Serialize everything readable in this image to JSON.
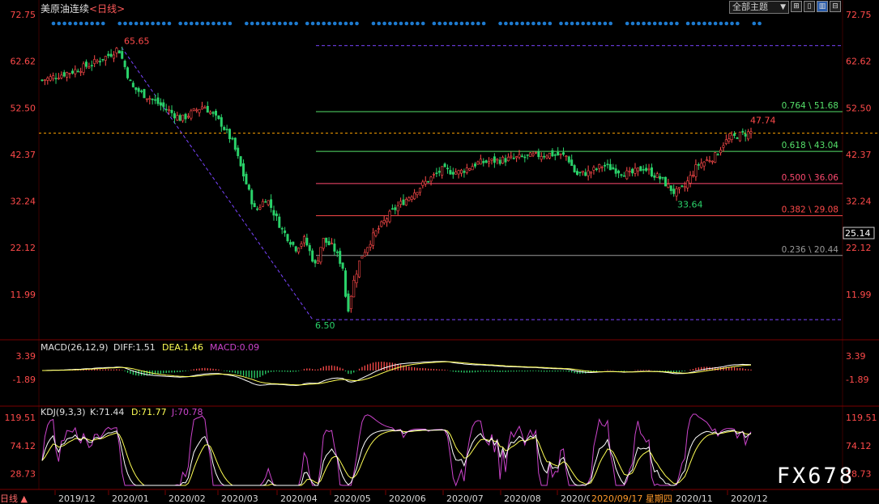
{
  "header": {
    "instrument": "美原油连续",
    "period": "<日线>",
    "theme_selector": "全部主题",
    "theme_arrow": "▼",
    "toolbar_icons": [
      "grid-icon",
      "layout-icon",
      "chart-icon",
      "settings-icon"
    ]
  },
  "colors": {
    "background": "#000000",
    "up": "#ff4a4a",
    "down": "#2ad26a",
    "axis_text": "#ff4a4a",
    "dif_line": "#ffffff",
    "dea_line": "#ffff55",
    "macd_label": "#cc44cc",
    "k_line": "#ffffff",
    "d_line": "#ffff55",
    "j_line": "#cc44cc",
    "fib_764": "#55e06a",
    "fib_618": "#55e06a",
    "fib_500": "#ff4a70",
    "fib_382": "#ff4a4a",
    "fib_236": "#9a9a9a",
    "dashed_purple": "#7a44ff",
    "current_price_line": "#ffa500",
    "dot_strip": "#1e7bd0",
    "watermark": "#ffffff"
  },
  "price_axis": {
    "ticks": [
      "72.75",
      "62.62",
      "52.50",
      "42.37",
      "32.24",
      "22.12",
      "11.99"
    ],
    "current_price": "25.14"
  },
  "time_axis": {
    "labels": [
      "2019/12",
      "2020/01",
      "2020/02",
      "2020/03",
      "2020/04",
      "2020/05",
      "2020/06",
      "2020/07",
      "2020/08",
      "2020/0",
      "2020/11",
      "2020/12"
    ],
    "cursor_label": "2020/09/17 星期四",
    "left_marker": "日线 ▲"
  },
  "annotations": {
    "high": "65.65",
    "low": "6.50",
    "recent_high": "47.74",
    "recent_low": "33.64"
  },
  "fibonacci": [
    {
      "ratio": "0.764",
      "level": "51.68",
      "label": "0.764 \\ 51.68"
    },
    {
      "ratio": "0.618",
      "level": "43.04",
      "label": "0.618 \\ 43.04"
    },
    {
      "ratio": "0.500",
      "level": "36.06",
      "label": "0.500 \\ 36.06"
    },
    {
      "ratio": "0.382",
      "level": "29.08",
      "label": "0.382 \\ 29.08"
    },
    {
      "ratio": "0.236",
      "level": "20.44",
      "label": "0.236 \\ 20.44"
    }
  ],
  "macd": {
    "title": "MACD(26,12,9)",
    "dif_label": "DIFF:1.51",
    "dea_label": "DEA:1.46",
    "macd_label": "MACD:0.09",
    "axis": [
      "3.39",
      "-1.89"
    ]
  },
  "kdj": {
    "title": "KDJ(9,3,3)",
    "k_label": "K:71.44",
    "d_label": "D:71.77",
    "j_label": "J:70.78",
    "axis": [
      "119.51",
      "74.12",
      "28.73"
    ]
  },
  "watermark": "FX678",
  "chart_data": {
    "type": "candlestick",
    "instrument": "美原油连续",
    "interval": "日线",
    "price_range": [
      6.0,
      72.75
    ],
    "closes_approx": [
      {
        "x": "2019/12",
        "y": 58.5
      },
      {
        "x": "2020/01",
        "y": 65.65
      },
      {
        "x": "2020/02",
        "y": 50.5
      },
      {
        "x": "2020/03",
        "y": 30.0
      },
      {
        "x": "2020/04",
        "y": 6.5
      },
      {
        "x": "2020/05",
        "y": 33.0
      },
      {
        "x": "2020/06",
        "y": 39.0
      },
      {
        "x": "2020/07",
        "y": 41.0
      },
      {
        "x": "2020/08",
        "y": 42.5
      },
      {
        "x": "2020/09",
        "y": 38.5
      },
      {
        "x": "2020/10",
        "y": 39.5
      },
      {
        "x": "2020/11",
        "y": 42.0
      },
      {
        "x": "2020/12",
        "y": 47.74
      }
    ]
  }
}
